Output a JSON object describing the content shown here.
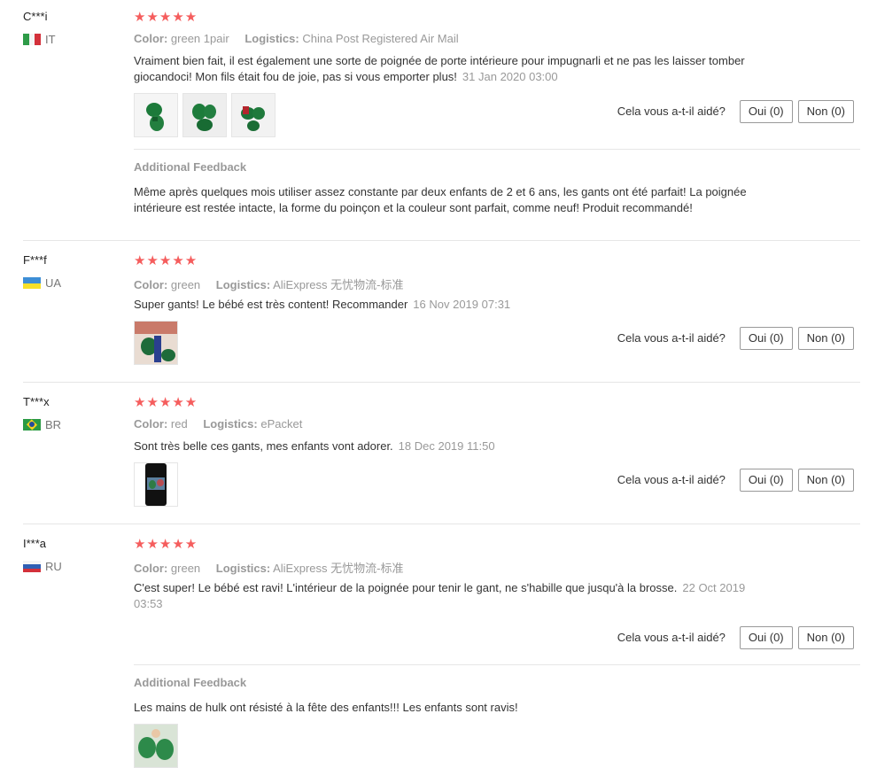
{
  "helpful_prompt": "Cela vous a-t-il aidé?",
  "reviews": [
    {
      "user": "C***i",
      "country": "IT",
      "stars": "★★★★★",
      "color_label": "Color:",
      "color_value": "green 1pair",
      "logistics_label": "Logistics:",
      "logistics_value": "China Post Registered Air Mail",
      "text": "Vraiment bien fait, il est également une sorte de poignée de porte intérieure pour impugnarli et ne pas les laisser tomber giocandoci! Mon fils était fou de joie, pas si vous emporter plus!",
      "date": "31 Jan 2020 03:00",
      "yes": "Oui (0)",
      "no": "Non (0)",
      "feedback_title": "Additional Feedback",
      "feedback_text": "Même après quelques mois utiliser assez constante par deux enfants de 2 et 6 ans, les gants ont été parfait! La poignée intérieure est restée intacte, la forme du poinçon et la couleur sont parfait, comme neuf! Produit recommandé!"
    },
    {
      "user": "F***f",
      "country": "UA",
      "stars": "★★★★★",
      "color_label": "Color:",
      "color_value": "green",
      "logistics_label": "Logistics:",
      "logistics_value": "AliExpress 无忧物流-标准",
      "text": "Super gants! Le bébé est très content! Recommander",
      "date": "16 Nov 2019 07:31",
      "yes": "Oui (0)",
      "no": "Non (0)"
    },
    {
      "user": "T***x",
      "country": "BR",
      "stars": "★★★★★",
      "color_label": "Color:",
      "color_value": "red",
      "logistics_label": "Logistics:",
      "logistics_value": "ePacket",
      "text": "Sont très belle ces gants, mes enfants vont adorer.",
      "date": "18 Dec 2019 11:50",
      "yes": "Oui (0)",
      "no": "Non (0)"
    },
    {
      "user": "I***a",
      "country": "RU",
      "stars": "★★★★★",
      "color_label": "Color:",
      "color_value": "green",
      "logistics_label": "Logistics:",
      "logistics_value": "AliExpress 无忧物流-标准",
      "text": "C'est super! Le bébé est ravi! L'intérieur de la poignée pour tenir le gant, ne s'habille que jusqu'à la brosse.",
      "date": "22 Oct 2019 03:53",
      "yes": "Oui (0)",
      "no": "Non (0)",
      "feedback_title": "Additional Feedback",
      "feedback_text": "Les mains de hulk ont résisté à la fête des enfants!!! Les enfants sont ravis!"
    }
  ]
}
